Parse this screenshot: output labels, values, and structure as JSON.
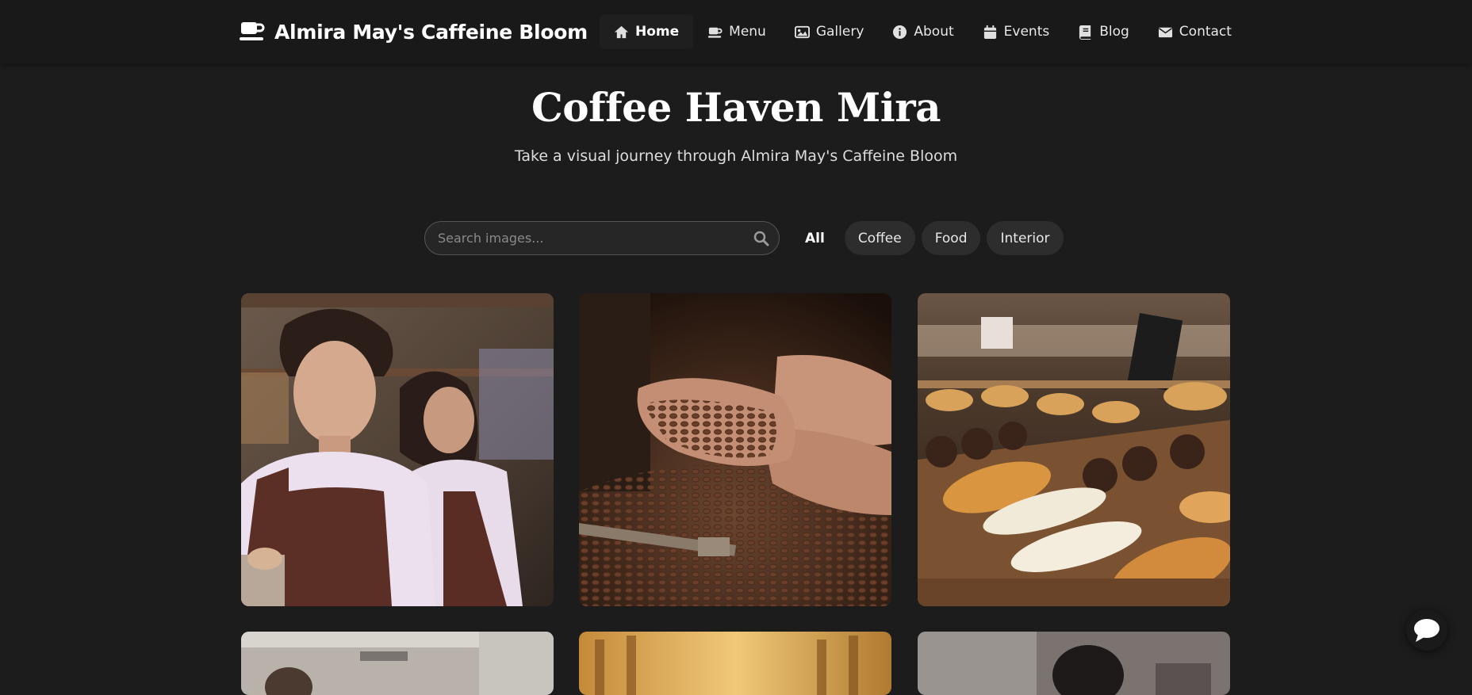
{
  "brand": {
    "title": "Almira May's Caffeine Bloom",
    "icon": "coffee-cup-icon"
  },
  "nav": {
    "items": [
      {
        "label": "Home",
        "icon": "home-icon",
        "active": true
      },
      {
        "label": "Menu",
        "icon": "coffee-cup-icon"
      },
      {
        "label": "Gallery",
        "icon": "image-icon"
      },
      {
        "label": "About",
        "icon": "info-icon"
      },
      {
        "label": "Events",
        "icon": "calendar-icon"
      },
      {
        "label": "Blog",
        "icon": "book-icon"
      },
      {
        "label": "Contact",
        "icon": "envelope-icon"
      }
    ]
  },
  "hero": {
    "title": "Coffee Haven Mira",
    "subtitle": "Take a visual journey through Almira May's Caffeine Bloom"
  },
  "search": {
    "placeholder": "Search images...",
    "value": ""
  },
  "filters": {
    "items": [
      {
        "label": "All",
        "active": true
      },
      {
        "label": "Coffee"
      },
      {
        "label": "Food"
      },
      {
        "label": "Interior"
      }
    ]
  },
  "gallery": {
    "items": [
      {
        "subject": "baristas-photo"
      },
      {
        "subject": "coffee-beans-photo"
      },
      {
        "subject": "pastries-photo"
      },
      {
        "subject": "cafe-counter-photo"
      },
      {
        "subject": "coffee-bar-photo"
      },
      {
        "subject": "barista-portrait-photo"
      }
    ]
  },
  "colors": {
    "background": "#1c1c1c",
    "navbar": "#191919",
    "text": "#ffffff",
    "muted_text": "#dddddd",
    "pill": "#2d2d2d"
  },
  "chat": {
    "icon": "chat-bubble-icon"
  }
}
